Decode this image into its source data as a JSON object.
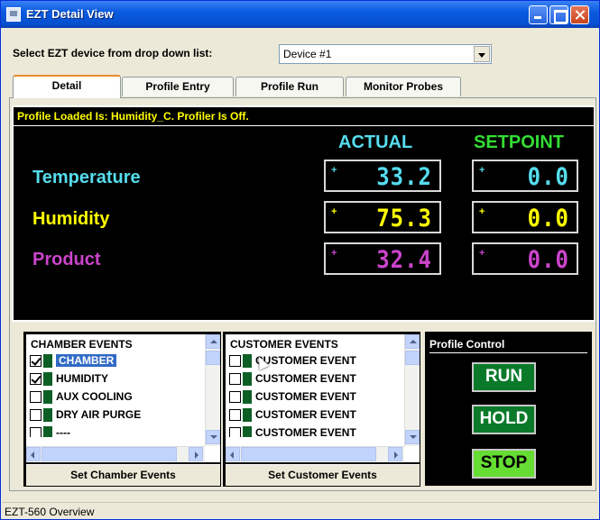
{
  "window": {
    "title": "EZT Detail View",
    "icon": "app-window-icon"
  },
  "device_select": {
    "label": "Select EZT device from drop down list:",
    "value": "Device #1"
  },
  "tabs": [
    {
      "label": "Detail",
      "active": true
    },
    {
      "label": "Profile Entry",
      "active": false
    },
    {
      "label": "Profile Run",
      "active": false
    },
    {
      "label": "Monitor Probes",
      "active": false
    }
  ],
  "detail": {
    "status_line": "Profile Loaded Is: Humidity_C. Profiler Is Off.",
    "actual_header": "ACTUAL",
    "setpoint_header": "SETPOINT",
    "rows": [
      {
        "label": "Temperature",
        "actual": "33.2",
        "setpoint": "0.0",
        "color": "#55ddee"
      },
      {
        "label": "Humidity",
        "actual": "75.3",
        "setpoint": "0.0",
        "color": "#ffff00"
      },
      {
        "label": "Product",
        "actual": "32.4",
        "setpoint": "0.0",
        "color": "#cc44cc"
      }
    ]
  },
  "chamber_events": {
    "header": "CHAMBER EVENTS",
    "items": [
      {
        "label": "CHAMBER",
        "checked": true,
        "selected": true
      },
      {
        "label": "HUMIDITY",
        "checked": true,
        "selected": false
      },
      {
        "label": "AUX COOLING",
        "checked": false,
        "selected": false
      },
      {
        "label": "DRY AIR PURGE",
        "checked": false,
        "selected": false
      },
      {
        "label": "----",
        "checked": false,
        "selected": false
      }
    ],
    "button": "Set Chamber Events"
  },
  "customer_events": {
    "header": "CUSTOMER EVENTS",
    "items": [
      {
        "label": "CUSTOMER EVENT",
        "checked": false
      },
      {
        "label": "CUSTOMER EVENT",
        "checked": false
      },
      {
        "label": "CUSTOMER EVENT",
        "checked": false
      },
      {
        "label": "CUSTOMER EVENT",
        "checked": false
      },
      {
        "label": "CUSTOMER EVENT",
        "checked": false
      }
    ],
    "button": "Set Customer Events"
  },
  "profile_control": {
    "title": "Profile Control",
    "run": "RUN",
    "hold": "HOLD",
    "stop": "STOP"
  },
  "status_bar": {
    "text": "EZT-560 Overview"
  },
  "colors": {
    "titlebar": "#0a5be0",
    "status_text": "#ffff00",
    "actual_header": "#55ddee",
    "setpoint_header": "#33dd33",
    "led": "#0e5f26",
    "button_green": "#0a7a2a",
    "stop_green": "#66dd33"
  }
}
